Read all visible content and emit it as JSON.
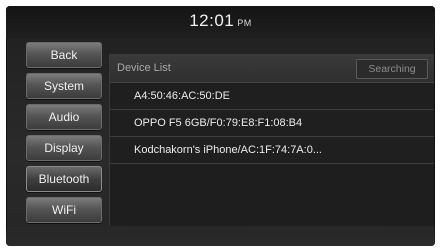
{
  "header": {
    "time": "12:01",
    "ampm": "PM"
  },
  "sidebar": {
    "items": [
      {
        "label": "Back"
      },
      {
        "label": "System"
      },
      {
        "label": "Audio"
      },
      {
        "label": "Display"
      },
      {
        "label": "Bluetooth",
        "active": true
      },
      {
        "label": "WiFi"
      }
    ]
  },
  "panel": {
    "title": "Device List",
    "search_label": "Searching",
    "devices": [
      {
        "name": "A4:50:46:AC:50:DE"
      },
      {
        "name": "OPPO F5 6GB/F0:79:E8:F1:08:B4"
      },
      {
        "name": "Kodchakorn's iPhone/AC:1F:74:7A:0..."
      }
    ]
  },
  "colors": {
    "background": "#262626",
    "panel": "#1e1e1e",
    "button": "#555555",
    "text": "#ececec"
  }
}
